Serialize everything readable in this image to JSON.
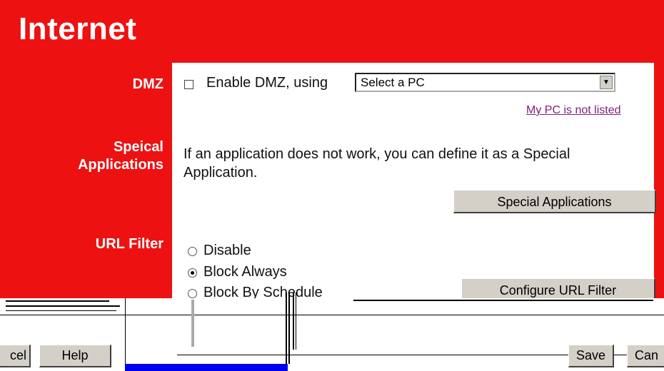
{
  "page": {
    "title": "Internet"
  },
  "dmz": {
    "label": "DMZ",
    "checkbox_label": "Enable DMZ, using",
    "select_value": "Select a PC",
    "link_text": "My PC is not listed"
  },
  "special_applications": {
    "label_line1": "Speical",
    "label_line2": "Applications",
    "description_line1": "If an application does not work, you can define it as a Special",
    "description_line2": "Application.",
    "button_label": "Special Applications"
  },
  "url_filter": {
    "label": "URL Filter",
    "options": [
      {
        "label": "Disable",
        "selected": false
      },
      {
        "label": "Block Always",
        "selected": true
      },
      {
        "label": "Block By Schedule",
        "selected": false
      }
    ],
    "configure_button_label": "Configure URL Filter"
  },
  "footer_buttons": {
    "cancel_left_partial": "cel",
    "help": "Help",
    "save": "Save",
    "cancel_right_partial": "Can"
  },
  "colors": {
    "brand_red": "#ee1111",
    "link": "#80207a",
    "button_face": "#d4d0c8",
    "glitch_blue": "#0000ee"
  }
}
